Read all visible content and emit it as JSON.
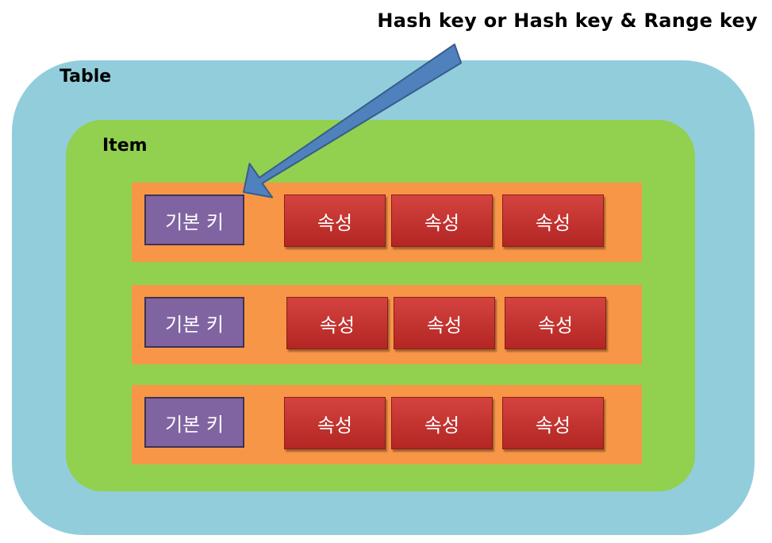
{
  "annotation": "Hash key or Hash key & Range key",
  "table": {
    "label": "Table"
  },
  "item": {
    "label": "Item"
  },
  "rows": [
    {
      "primary_key": "기본 키",
      "attributes": [
        "속성",
        "속성",
        "속성"
      ]
    },
    {
      "primary_key": "기본 키",
      "attributes": [
        "속성",
        "속성",
        "속성"
      ]
    },
    {
      "primary_key": "기본 키",
      "attributes": [
        "속성",
        "속성",
        "속성"
      ]
    }
  ],
  "colors": {
    "table": "#92cddc",
    "item": "#92d050",
    "row": "#f79646",
    "primary_key": "#8064a2",
    "attribute": "#c0504d",
    "arrow": "#4f81bd"
  }
}
